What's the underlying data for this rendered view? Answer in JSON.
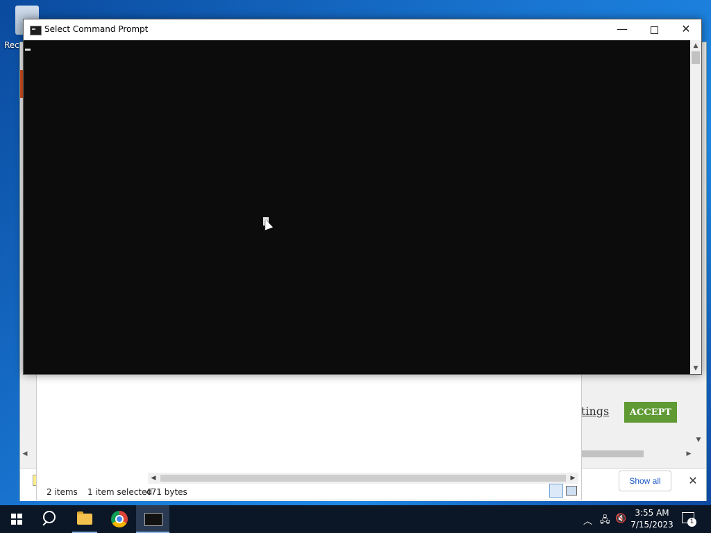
{
  "desktop": {
    "recycle_bin_label": "Rec"
  },
  "cmd_window": {
    "title": "Select Command Prompt",
    "minimize_glyph": "—",
    "close_glyph": "✕"
  },
  "browser": {
    "settings_link": "ettings",
    "accept_button": "ACCEPT",
    "show_all_button": "Show all",
    "close_glyph": "✕"
  },
  "explorer": {
    "item_count": "2 items",
    "selection": "1 item selected",
    "size": "471 bytes"
  },
  "taskbar": {
    "time": "3:55 AM",
    "date": "7/15/2023",
    "notification_count": "1"
  }
}
